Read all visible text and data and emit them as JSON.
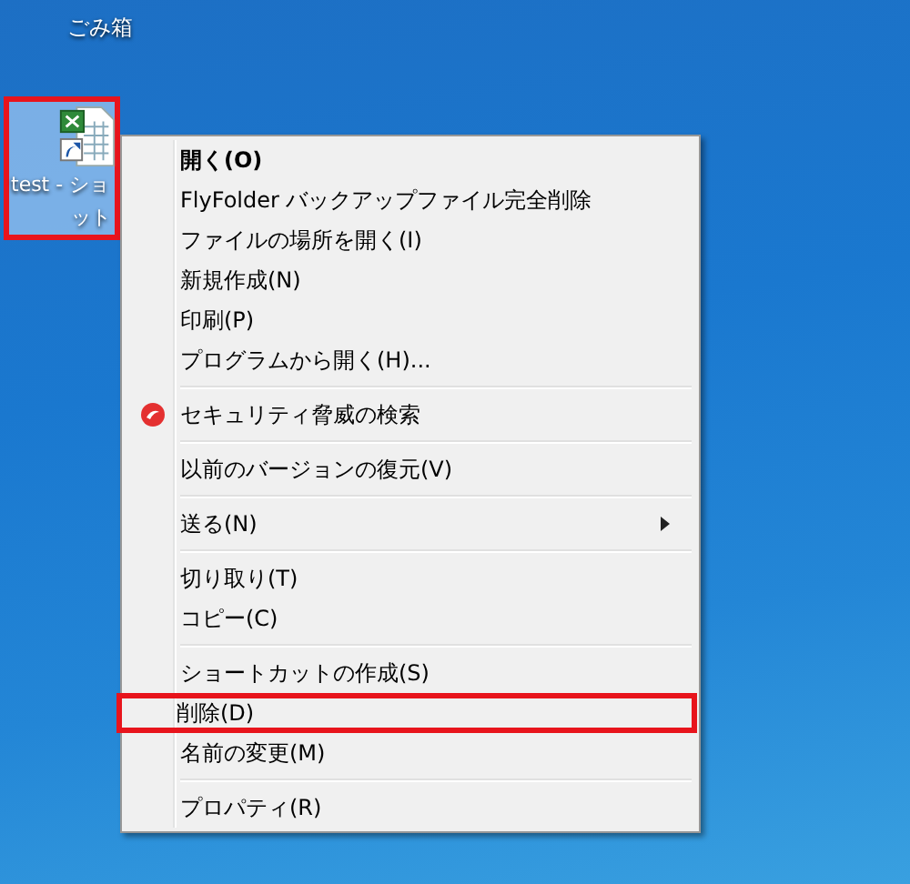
{
  "desktop_icons": [
    {
      "kind": "recycle-bin",
      "label_lines": [
        "ごみ箱"
      ],
      "selected": false,
      "highlighted": false
    },
    {
      "kind": "shortcut",
      "label_lines": [
        "test - ショ",
        "ット"
      ],
      "selected": true,
      "highlighted": true
    }
  ],
  "context_menu": {
    "groups": [
      [
        {
          "label": "開く(O)",
          "default": true,
          "kind": "plain",
          "highlighted": false
        },
        {
          "label": "FlyFolder バックアップファイル完全削除",
          "default": false,
          "kind": "plain",
          "highlighted": false
        },
        {
          "label": "ファイルの場所を開く(I)",
          "default": false,
          "kind": "plain",
          "highlighted": false
        },
        {
          "label": "新規作成(N)",
          "default": false,
          "kind": "plain",
          "highlighted": false
        },
        {
          "label": "印刷(P)",
          "default": false,
          "kind": "plain",
          "highlighted": false
        },
        {
          "label": "プログラムから開く(H)...",
          "default": false,
          "kind": "plain",
          "highlighted": false
        }
      ],
      [
        {
          "label": "セキュリティ脅威の検索",
          "default": false,
          "kind": "icon",
          "highlighted": false
        }
      ],
      [
        {
          "label": "以前のバージョンの復元(V)",
          "default": false,
          "kind": "plain",
          "highlighted": false
        }
      ],
      [
        {
          "label": "送る(N)",
          "default": false,
          "kind": "submenu",
          "highlighted": false
        }
      ],
      [
        {
          "label": "切り取り(T)",
          "default": false,
          "kind": "plain",
          "highlighted": false
        },
        {
          "label": "コピー(C)",
          "default": false,
          "kind": "plain",
          "highlighted": false
        }
      ],
      [
        {
          "label": "ショートカットの作成(S)",
          "default": false,
          "kind": "plain",
          "highlighted": false
        },
        {
          "label": "削除(D)",
          "default": false,
          "kind": "plain",
          "highlighted": true
        },
        {
          "label": "名前の変更(M)",
          "default": false,
          "kind": "plain",
          "highlighted": false
        }
      ],
      [
        {
          "label": "プロパティ(R)",
          "default": false,
          "kind": "plain",
          "highlighted": false
        }
      ]
    ]
  }
}
